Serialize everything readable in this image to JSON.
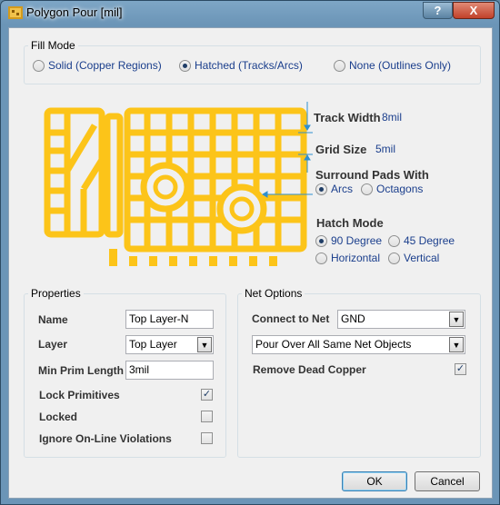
{
  "window": {
    "title": "Polygon Pour [mil]",
    "help_glyph": "?",
    "close_glyph": "X"
  },
  "fill_mode": {
    "legend": "Fill Mode",
    "options": [
      {
        "label": "Solid (Copper Regions)",
        "selected": false
      },
      {
        "label": "Hatched (Tracks/Arcs)",
        "selected": true
      },
      {
        "label": "None (Outlines Only)",
        "selected": false
      }
    ]
  },
  "preview": {
    "track_width_label": "Track Width",
    "track_width_value": "8mil",
    "grid_size_label": "Grid Size",
    "grid_size_value": "5mil",
    "surround_label": "Surround Pads With",
    "surround_options": [
      {
        "label": "Arcs",
        "selected": true
      },
      {
        "label": "Octagons",
        "selected": false
      }
    ],
    "hatch_label": "Hatch Mode",
    "hatch_options": [
      {
        "label": "90 Degree",
        "selected": true
      },
      {
        "label": "45 Degree",
        "selected": false
      },
      {
        "label": "Horizontal",
        "selected": false
      },
      {
        "label": "Vertical",
        "selected": false
      }
    ],
    "copper_color": "#fcc419",
    "dimension_color": "#2e8fd0"
  },
  "properties": {
    "legend": "Properties",
    "name_label": "Name",
    "name_value": "Top Layer-N",
    "layer_label": "Layer",
    "layer_value": "Top Layer",
    "min_prim_label": "Min Prim Length",
    "min_prim_value": "3mil",
    "lock_label": "Lock Primitives",
    "lock_checked": true,
    "locked_label": "Locked",
    "locked_checked": false,
    "ignore_label": "Ignore On-Line Violations",
    "ignore_checked": false
  },
  "net_options": {
    "legend": "Net Options",
    "connect_label": "Connect to Net",
    "connect_value": "GND",
    "pour_value": "Pour Over All Same Net Objects",
    "remove_label": "Remove Dead Copper",
    "remove_checked": true
  },
  "buttons": {
    "ok": "OK",
    "cancel": "Cancel"
  },
  "check_glyph": "✓",
  "arrow_glyph": "▼"
}
